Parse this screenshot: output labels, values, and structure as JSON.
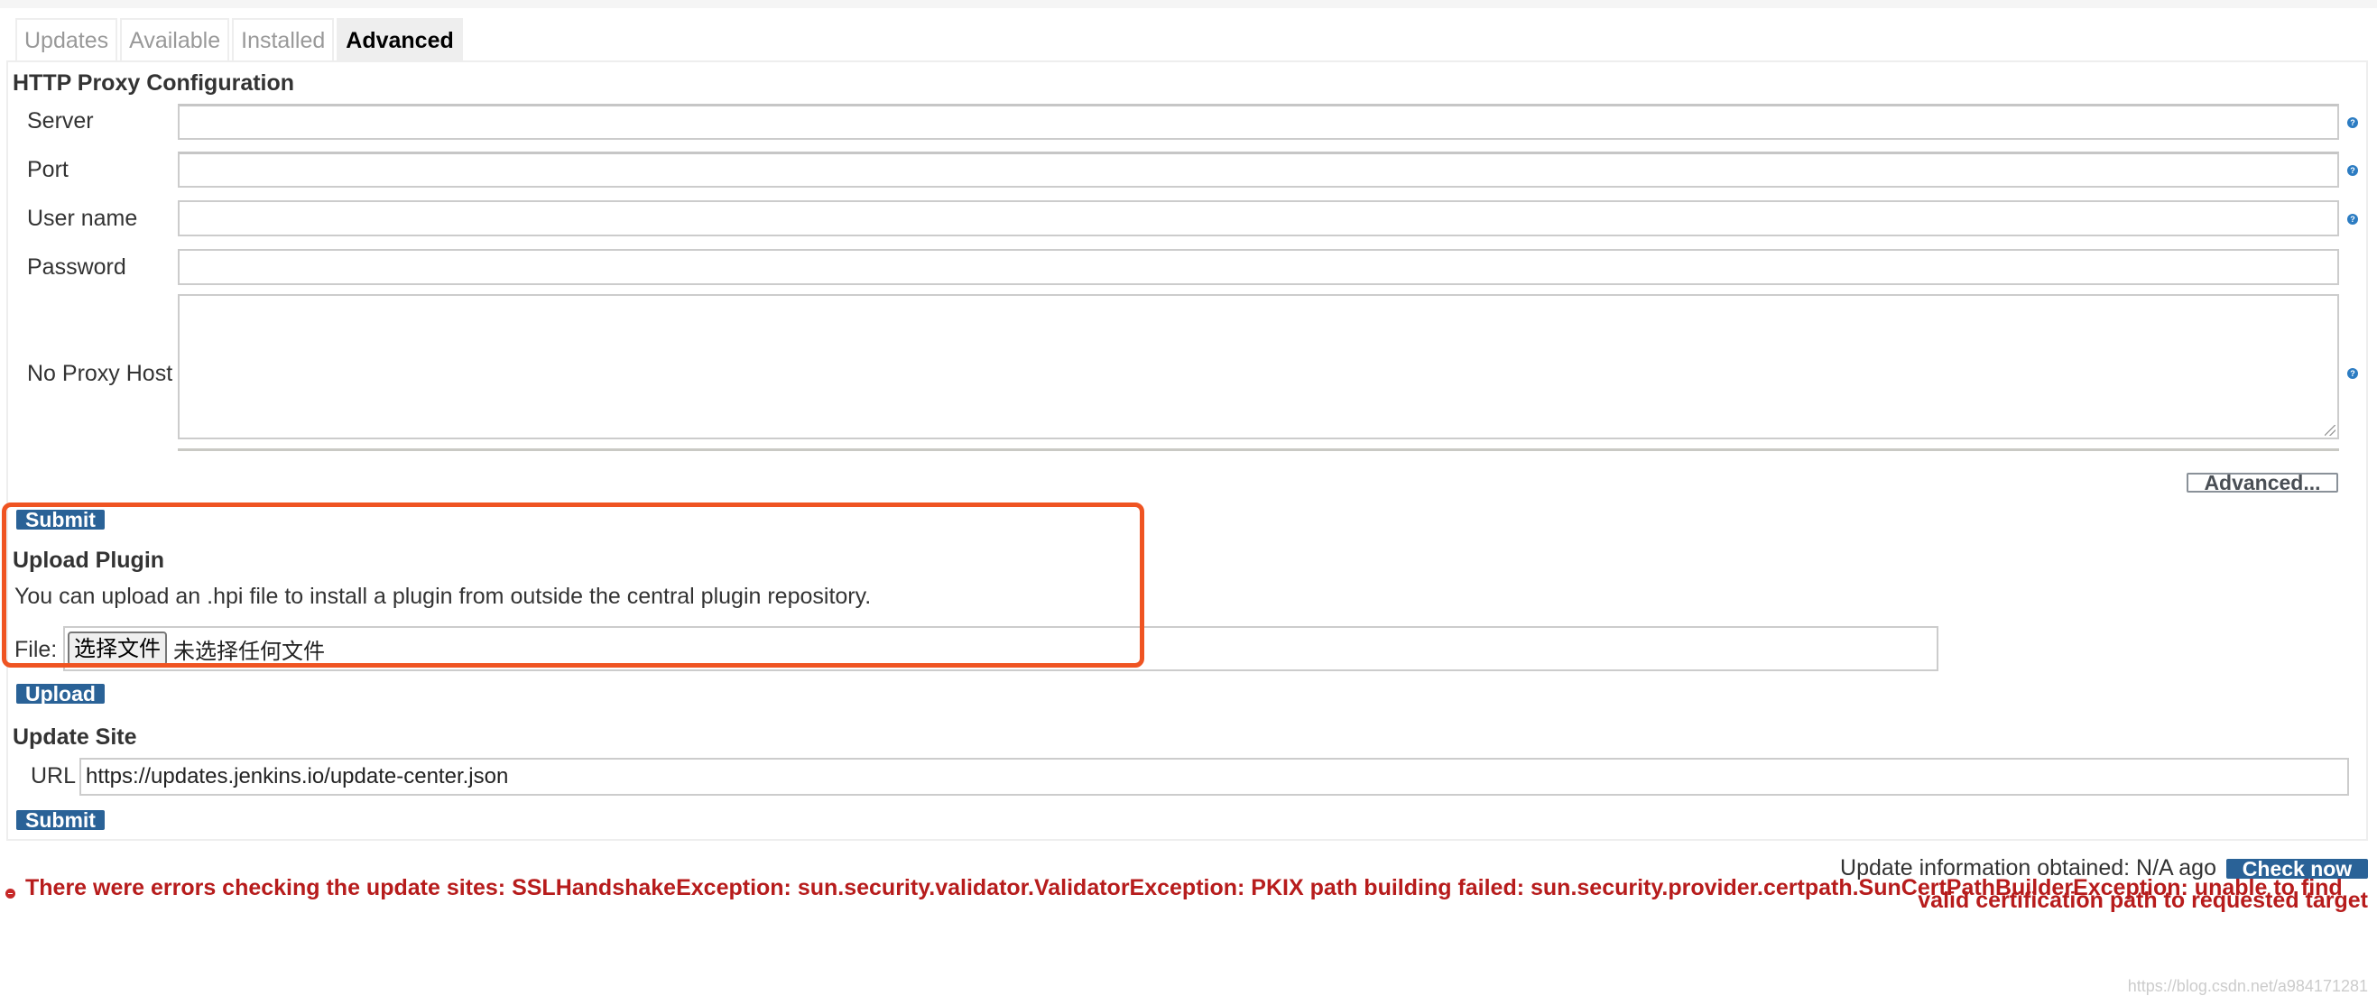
{
  "tabs": [
    {
      "label": "Updates",
      "active": false
    },
    {
      "label": "Available",
      "active": false
    },
    {
      "label": "Installed",
      "active": false
    },
    {
      "label": "Advanced",
      "active": true
    }
  ],
  "proxy": {
    "heading": "HTTP Proxy Configuration",
    "fields": {
      "server": {
        "label": "Server",
        "value": ""
      },
      "port": {
        "label": "Port",
        "value": ""
      },
      "username": {
        "label": "User name",
        "value": ""
      },
      "password": {
        "label": "Password",
        "value": ""
      },
      "no_proxy_host": {
        "label": "No Proxy Host",
        "value": ""
      }
    },
    "help_glyph": "?",
    "advanced_label": "Advanced...",
    "submit_label": "Submit"
  },
  "upload": {
    "heading": "Upload Plugin",
    "description": "You can upload an .hpi file to install a plugin from outside the central plugin repository.",
    "file_label": "File:",
    "choose_file_label": "选择文件",
    "no_file_text": "未选择任何文件",
    "upload_label": "Upload"
  },
  "update_site": {
    "heading": "Update Site",
    "url_label": "URL",
    "url_value": "https://updates.jenkins.io/update-center.json",
    "submit_label": "Submit"
  },
  "status": {
    "update_info": "Update information obtained: N/A ago",
    "check_now_label": "Check now",
    "error_line1": "There were errors checking the update sites: SSLHandshakeException: sun.security.validator.ValidatorException: PKIX path building failed: sun.security.provider.certpath.SunCertPathBuilderException: unable to find",
    "error_line2": "valid certification path to requested target"
  },
  "watermark": "https://blog.csdn.net/a984171281",
  "colors": {
    "button": "#2a6297",
    "error": "#b71c1c",
    "highlight_box": "#ef5422",
    "help": "#2c7cc2"
  }
}
